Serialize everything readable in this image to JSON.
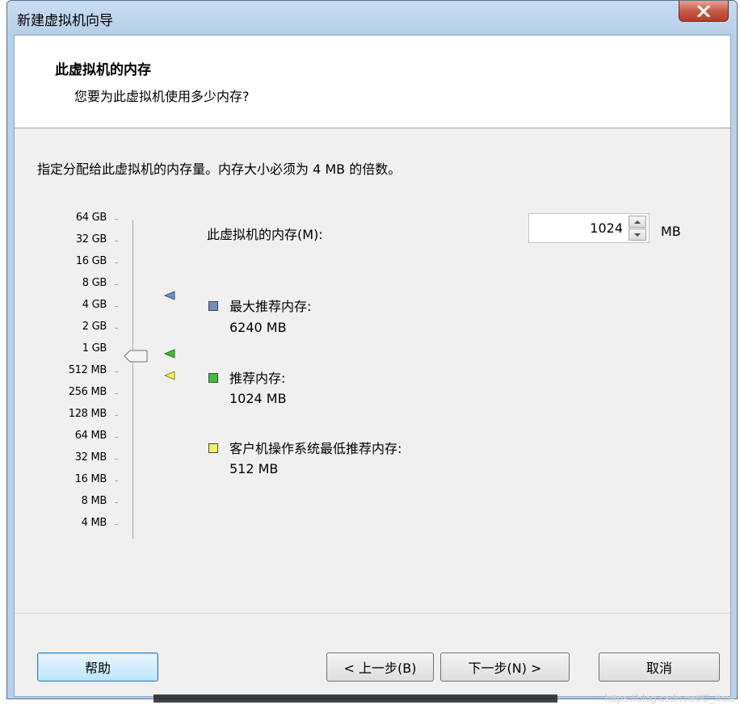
{
  "window": {
    "title": "新建虚拟机向导"
  },
  "header": {
    "title": "此虚拟机的内存",
    "subtitle": "您要为此虚拟机使用多少内存?"
  },
  "instruction": "指定分配给此虚拟机的内存量。内存大小必须为 4 MB 的倍数。",
  "scale": {
    "labels": [
      "64 GB",
      "32 GB",
      "16 GB",
      "8 GB",
      "4 GB",
      "2 GB",
      "1 GB",
      "512 MB",
      "256 MB",
      "128 MB",
      "64 MB",
      "32 MB",
      "16 MB",
      "8 MB",
      "4 MB"
    ],
    "current_level": "1 GB"
  },
  "memory": {
    "label": "此虚拟机的内存(M):",
    "value": "1024",
    "unit": "MB"
  },
  "legend": {
    "max": {
      "title": "最大推荐内存:",
      "value": "6240 MB",
      "color": "#6f8fbf"
    },
    "recommended": {
      "title": "推荐内存:",
      "value": "1024 MB",
      "color": "#3dbf3d"
    },
    "guest_min": {
      "title": "客户机操作系统最低推荐内存:",
      "value": "512 MB",
      "color": "#f2f260"
    }
  },
  "buttons": {
    "help": "帮助",
    "back": "< 上一步(B)",
    "next": "下一步(N) >",
    "cancel": "取消"
  },
  "watermark": "https://blog.csdn.net/C_time"
}
